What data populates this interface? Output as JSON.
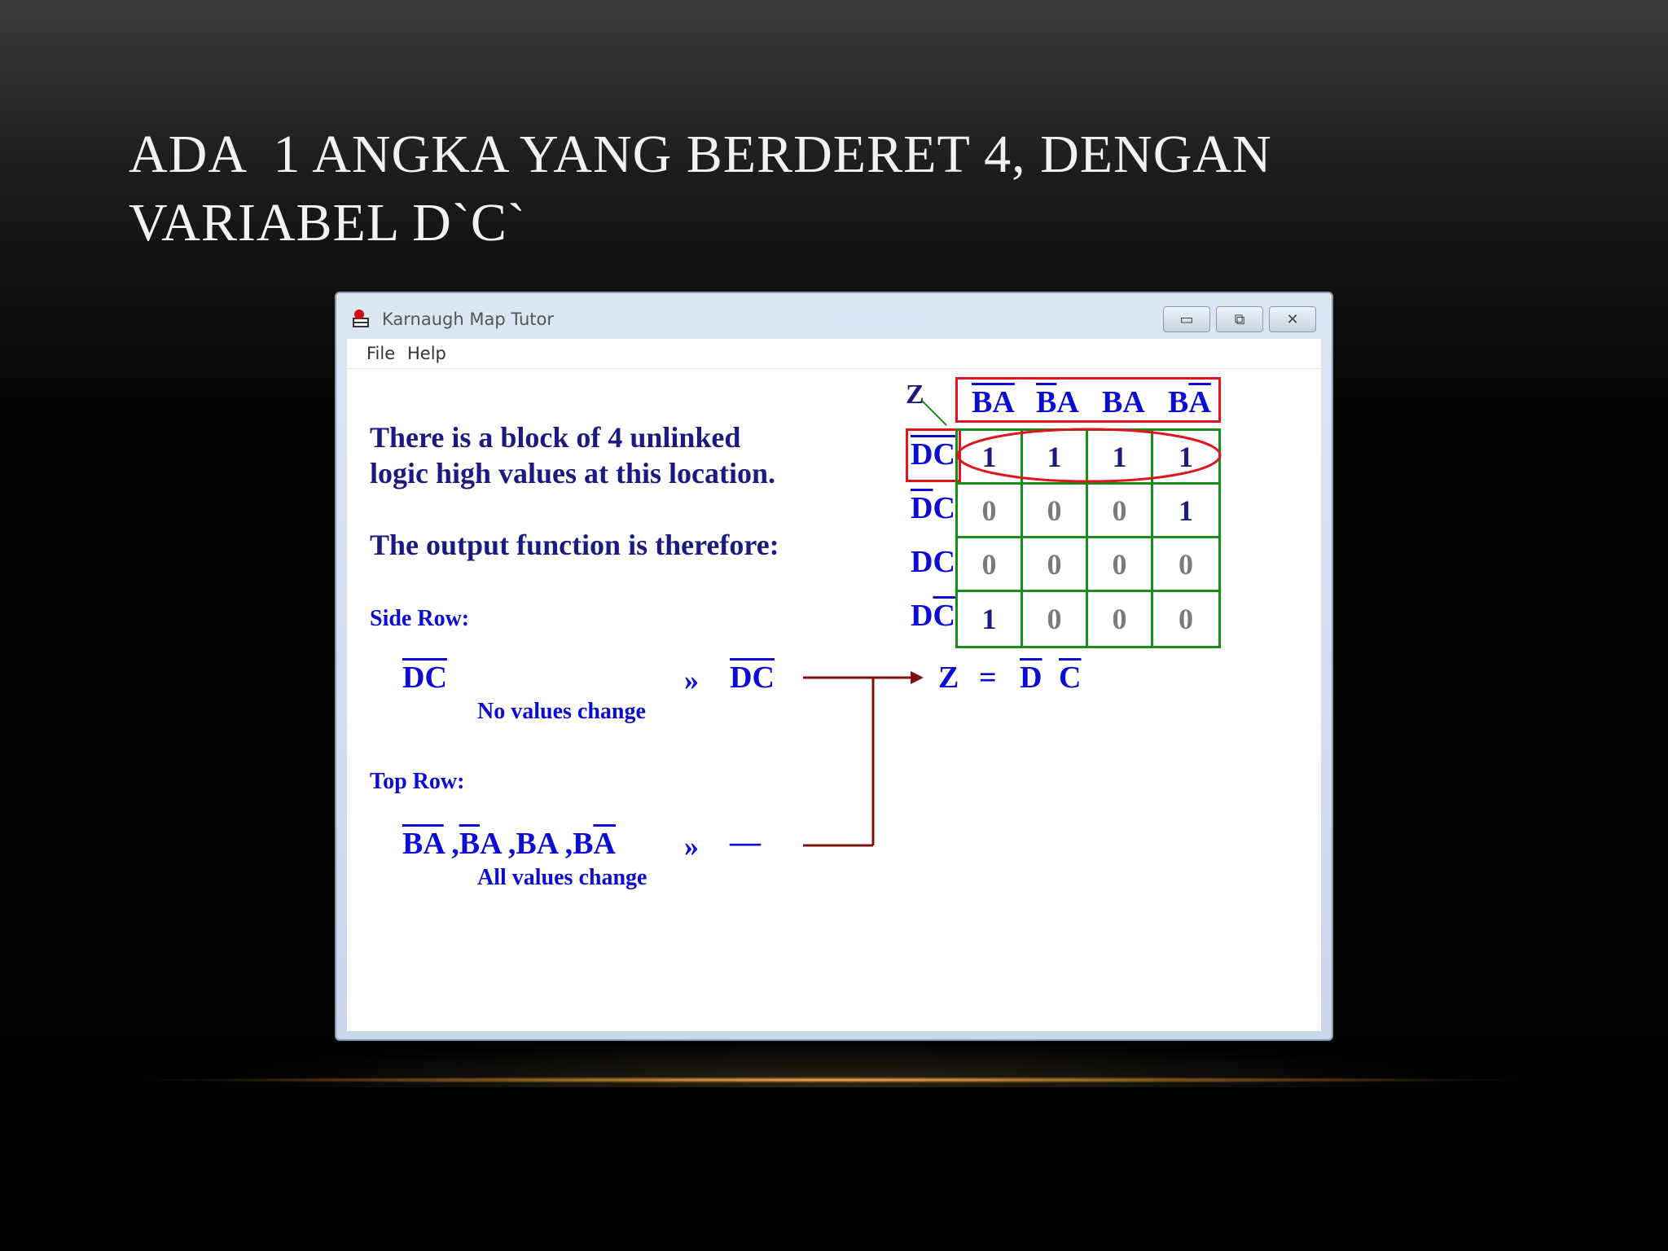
{
  "slide": {
    "title_line1": "ADA  1 ANGKA YANG BERDERET 4, DENGAN",
    "title_line2": "VARIABEL D`C`"
  },
  "window": {
    "title": "Karnaugh Map Tutor",
    "controls": {
      "minimize": "▭",
      "maximize": "⧉",
      "close": "✕"
    },
    "icon": "app-icon"
  },
  "menu": {
    "file": "File",
    "help": "Help"
  },
  "explanation": {
    "line1": "There is a block of 4 unlinked",
    "line2": "logic high values at this location.",
    "line3": "The output function is therefore:"
  },
  "kmap": {
    "corner": "Z",
    "columns": [
      "BA",
      "BA",
      "BA",
      "BA"
    ],
    "rows": [
      "DC",
      "DC",
      "DC",
      "DC"
    ],
    "values": [
      [
        "1",
        "1",
        "1",
        "1"
      ],
      [
        "0",
        "0",
        "0",
        "1"
      ],
      [
        "0",
        "0",
        "0",
        "0"
      ],
      [
        "1",
        "0",
        "0",
        "0"
      ]
    ],
    "colors": {
      "grid": "#1a8c1a",
      "highlight": "#e0141e",
      "ones": "#1a1a80",
      "zeros": "#7a7a7a"
    }
  },
  "side_row": {
    "label": "Side Row:",
    "term": "DC",
    "arrow": "»",
    "result": "DC",
    "note": "No values change"
  },
  "top_row": {
    "label": "Top Row:",
    "terms": "BA ,BA ,BA ,BA",
    "arrow": "»",
    "result": "—",
    "note": "All values change"
  },
  "output": {
    "z": "Z",
    "eq": "=",
    "d": "D",
    "c": "C"
  }
}
